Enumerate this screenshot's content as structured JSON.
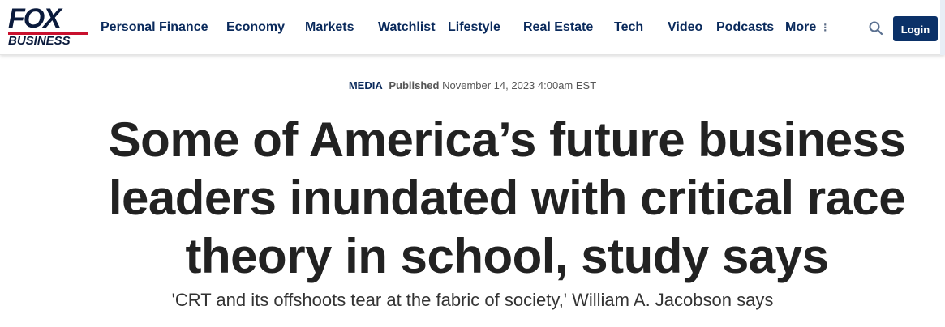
{
  "brand": {
    "logo_top": "FOX",
    "logo_bottom": "BUSINESS",
    "navy": "#0a1a3c",
    "accent_red": "#c8102e",
    "button_blue": "#0b3168"
  },
  "nav": {
    "items": [
      {
        "label": "Personal Finance"
      },
      {
        "label": "Economy"
      },
      {
        "label": "Markets"
      },
      {
        "label": "Watchlist"
      },
      {
        "label": "Lifestyle"
      },
      {
        "label": "Real Estate"
      },
      {
        "label": "Tech"
      },
      {
        "label": "Video"
      },
      {
        "label": "Podcasts"
      }
    ],
    "more_label": "More",
    "more_icon": "vertical-dots-icon",
    "search_icon": "search-icon",
    "login_label": "Login"
  },
  "article": {
    "category": "MEDIA",
    "published_label": "Published",
    "date": "November 14, 2023 4:00am EST",
    "headline": "Some of America’s future business leaders inundated with critical race theory in school, study says",
    "dek": "'CRT and its offshoots tear at the fabric of society,' William A. Jacobson says"
  }
}
